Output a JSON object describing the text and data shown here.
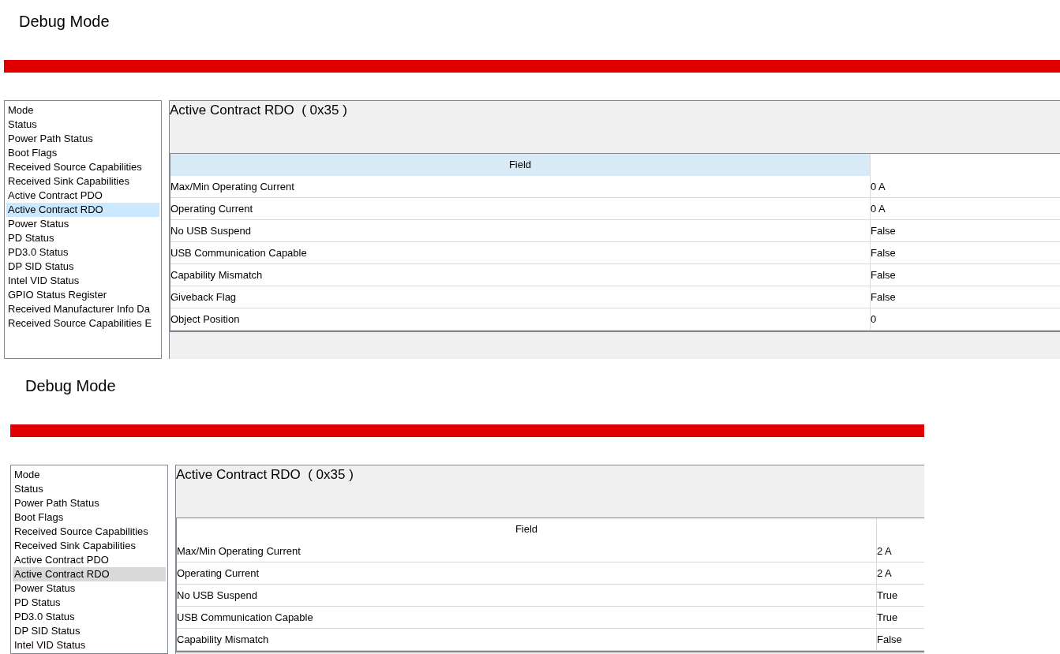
{
  "panels": [
    {
      "title": "Debug Mode",
      "focused": true,
      "list": [
        {
          "label": "Mode",
          "selected": false
        },
        {
          "label": "Status",
          "selected": false
        },
        {
          "label": "Power Path Status",
          "selected": false
        },
        {
          "label": "Boot Flags",
          "selected": false
        },
        {
          "label": "Received Source Capabilities",
          "selected": false
        },
        {
          "label": "Received Sink Capabilities",
          "selected": false
        },
        {
          "label": "Active Contract PDO",
          "selected": false
        },
        {
          "label": "Active Contract RDO",
          "selected": true
        },
        {
          "label": "Power Status",
          "selected": false
        },
        {
          "label": "PD Status",
          "selected": false
        },
        {
          "label": "PD3.0 Status",
          "selected": false
        },
        {
          "label": "DP SID Status",
          "selected": false
        },
        {
          "label": "Intel VID Status",
          "selected": false
        },
        {
          "label": "GPIO Status Register",
          "selected": false
        },
        {
          "label": "Received Manufacturer Info Da",
          "selected": false
        },
        {
          "label": "Received Source Capabilities E",
          "selected": false
        }
      ],
      "register_title": "Active Contract RDO  ( 0x35 )",
      "table": {
        "columns": [
          "Field"
        ],
        "rows": [
          [
            "Max/Min Operating Current",
            "0 A"
          ],
          [
            "Operating Current",
            "0 A"
          ],
          [
            "No USB Suspend",
            "False"
          ],
          [
            "USB Communication Capable",
            "False"
          ],
          [
            "Capability Mismatch",
            "False"
          ],
          [
            "Giveback Flag",
            "False"
          ],
          [
            "Object Position",
            "0"
          ]
        ]
      }
    },
    {
      "title": "Debug Mode",
      "focused": false,
      "list": [
        {
          "label": "Mode",
          "selected": false
        },
        {
          "label": "Status",
          "selected": false
        },
        {
          "label": "Power Path Status",
          "selected": false
        },
        {
          "label": "Boot Flags",
          "selected": false
        },
        {
          "label": "Received Source Capabilities",
          "selected": false
        },
        {
          "label": "Received Sink Capabilities",
          "selected": false
        },
        {
          "label": "Active Contract PDO",
          "selected": false
        },
        {
          "label": "Active Contract RDO",
          "selected": true
        },
        {
          "label": "Power Status",
          "selected": false
        },
        {
          "label": "PD Status",
          "selected": false
        },
        {
          "label": "PD3.0 Status",
          "selected": false
        },
        {
          "label": "DP SID Status",
          "selected": false
        },
        {
          "label": "Intel VID Status",
          "selected": false
        }
      ],
      "register_title": "Active Contract RDO  ( 0x35 )",
      "table": {
        "columns": [
          "Field"
        ],
        "rows": [
          [
            "Max/Min Operating Current",
            "2 A"
          ],
          [
            "Operating Current",
            "2 A"
          ],
          [
            "No USB Suspend",
            "True"
          ],
          [
            "USB Communication Capable",
            "True"
          ],
          [
            "Capability Mismatch",
            "False"
          ]
        ]
      }
    }
  ]
}
